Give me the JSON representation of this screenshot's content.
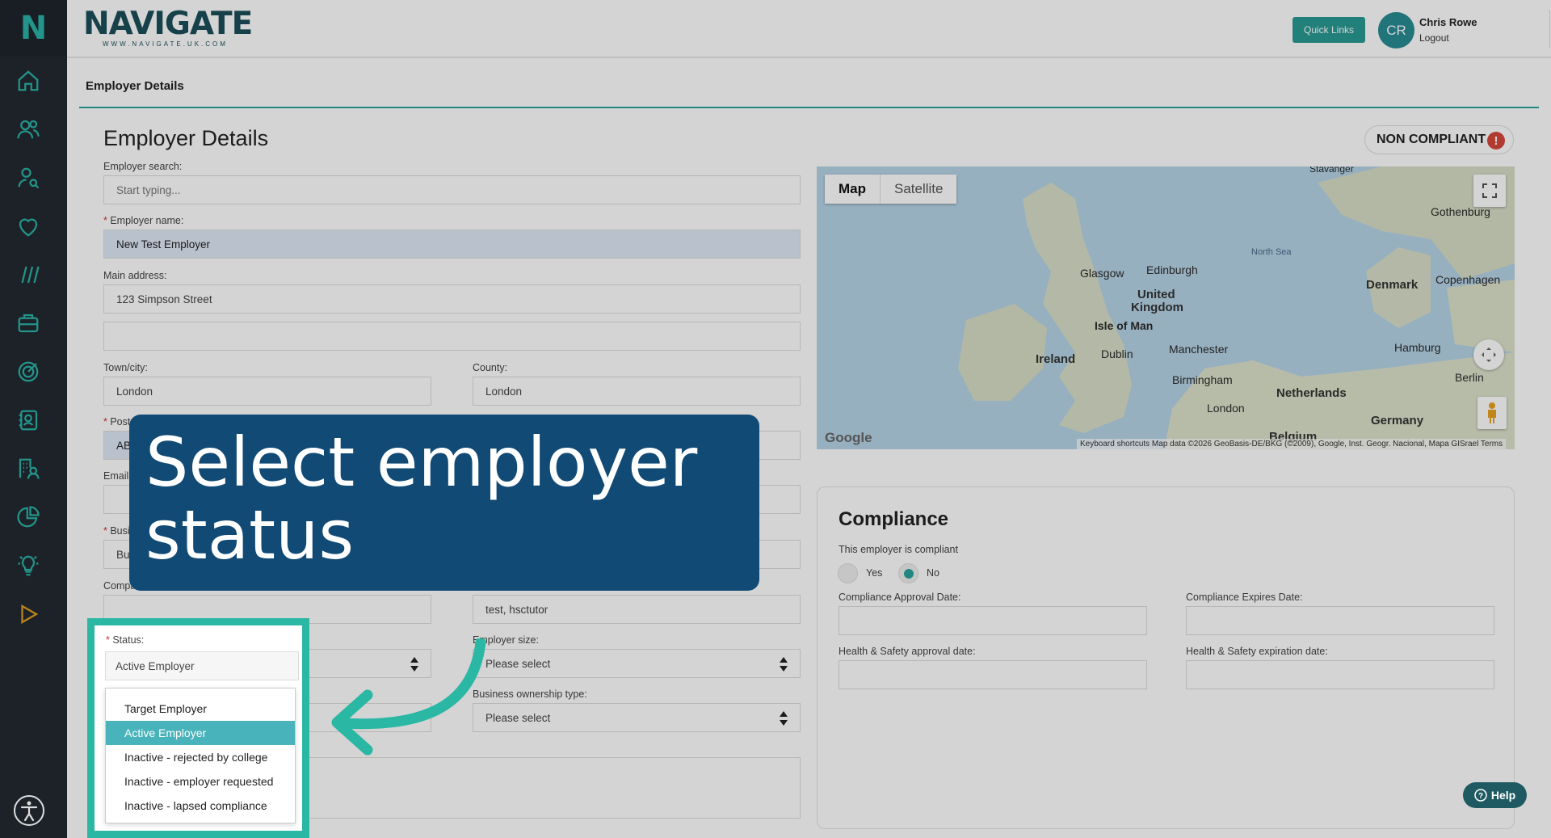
{
  "brand": {
    "name": "NAVIGATE",
    "url_text": "WWW.NAVIGATE.UK.COM",
    "sidebar_logo": "N"
  },
  "header": {
    "quick_links": "Quick Links",
    "avatar_initials": "CR",
    "user_name": "Chris Rowe",
    "logout": "Logout"
  },
  "sidebar": {
    "icons": [
      "home-icon",
      "users-icon",
      "user-search-icon",
      "heart-icon",
      "slashes-icon",
      "briefcase-icon",
      "target-icon",
      "contacts-icon",
      "building-users-icon",
      "pie-chart-icon",
      "lightbulb-icon",
      "play-icon"
    ]
  },
  "tab": {
    "label": "Employer Details"
  },
  "form": {
    "title": "Employer Details",
    "employer_search": {
      "label": "Employer search:",
      "placeholder": "Start typing..."
    },
    "employer_name": {
      "label": "Employer name:",
      "value": "New Test Employer"
    },
    "main_address": {
      "label": "Main address:",
      "value": "123 Simpson Street"
    },
    "town": {
      "label": "Town/city:",
      "value": "London"
    },
    "county": {
      "label": "County:",
      "value": "London"
    },
    "postcode": {
      "label_partial": "Post",
      "value_partial": "AB"
    },
    "email": {
      "label_partial": "Email"
    },
    "business": {
      "label_partial": "Busi",
      "value_partial": "Bus"
    },
    "company": {
      "label_partial": "Compa"
    },
    "sector_value": "test, hsctutor",
    "status": {
      "label": "Status:",
      "value": "Active Employer",
      "options": [
        "Target Employer",
        "Active Employer",
        "Inactive - rejected by college",
        "Inactive - employer requested",
        "Inactive - lapsed compliance"
      ]
    },
    "employer_size": {
      "label": "Employer size:",
      "placeholder": "Please select"
    },
    "ownership": {
      "label": "Business ownership type:",
      "placeholder": "Please select"
    }
  },
  "compliance_badge": {
    "label": "NON COMPLIANT",
    "icon": "!"
  },
  "map": {
    "tabs": [
      "Map",
      "Satellite"
    ],
    "labels": [
      "Stavanger",
      "Gothenburg",
      "North Sea",
      "Glasgow",
      "Edinburgh",
      "United",
      "Kingdom",
      "Isle of Man",
      "Denmark",
      "Copenhagen",
      "Ireland",
      "Dublin",
      "Manchester",
      "Hamburg",
      "Birmingham",
      "Berlin",
      "Netherlands",
      "London",
      "Germany",
      "Belgium"
    ],
    "google": "Google",
    "attribution": "Keyboard shortcuts    Map data ©2026 GeoBasis-DE/BKG (©2009), Google, Inst. Geogr. Nacional, Mapa GISrael    Terms"
  },
  "compliance": {
    "title": "Compliance",
    "question": "This employer is compliant",
    "yes": "Yes",
    "no": "No",
    "selected": "No",
    "approval_date": "Compliance Approval Date:",
    "expires_date": "Compliance Expires Date:",
    "hs_approval": "Health & Safety approval date:",
    "hs_expiration": "Health & Safety expiration date:"
  },
  "callout": {
    "line1": "Select employer",
    "line2": "status"
  },
  "help": "Help",
  "colors": {
    "accent": "#2aa39a",
    "sidebar": "#232a31",
    "callout": "#114a75",
    "highlight": "#2ab8a5"
  }
}
